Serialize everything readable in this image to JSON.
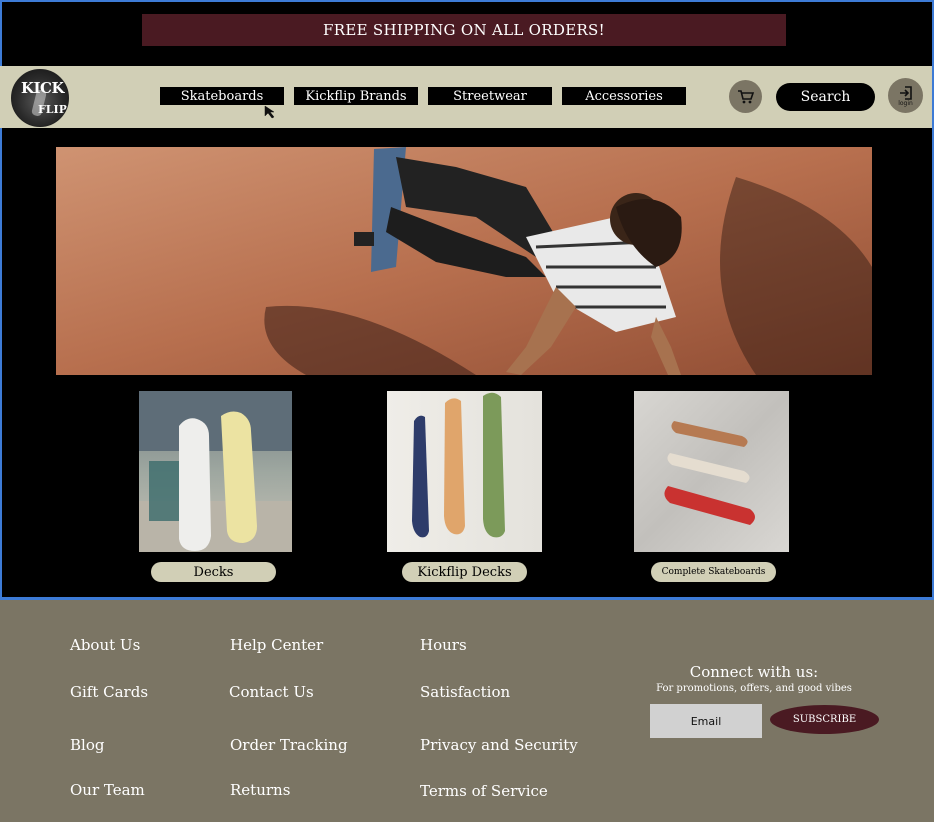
{
  "promo": {
    "text": "FREE SHIPPING ON ALL ORDERS!"
  },
  "logo": {
    "line1": "KICK",
    "line2": "FLIP"
  },
  "nav": {
    "items": [
      {
        "label": "Skateboards"
      },
      {
        "label": "Kickflip Brands"
      },
      {
        "label": "Streetwear"
      },
      {
        "label": "Accessories"
      }
    ],
    "search_label": "Search",
    "login_label": "login",
    "cart_icon": "cart-icon",
    "login_icon": "login-icon"
  },
  "products": [
    {
      "label": "Decks"
    },
    {
      "label": "Kickflip Decks"
    },
    {
      "label": "Complete Skateboards"
    }
  ],
  "footer": {
    "col1": [
      "About Us",
      "Gift Cards",
      "Blog",
      "Our Team"
    ],
    "col2": [
      "Help Center",
      "Contact Us",
      "Order Tracking",
      "Returns"
    ],
    "col3": [
      "Hours",
      "Satisfaction",
      "Privacy and Security",
      "Terms of Service"
    ],
    "connect_title": "Connect with us:",
    "connect_sub": "For promotions, offers, and good vibes",
    "email_placeholder": "Email",
    "subscribe_label": "SUBSCRIBE"
  },
  "colors": {
    "promo_bg": "#4a1a22",
    "nav_bg": "#d1cfb6",
    "footer_bg": "#7b7564",
    "accent_blue": "#3d7bd6"
  }
}
